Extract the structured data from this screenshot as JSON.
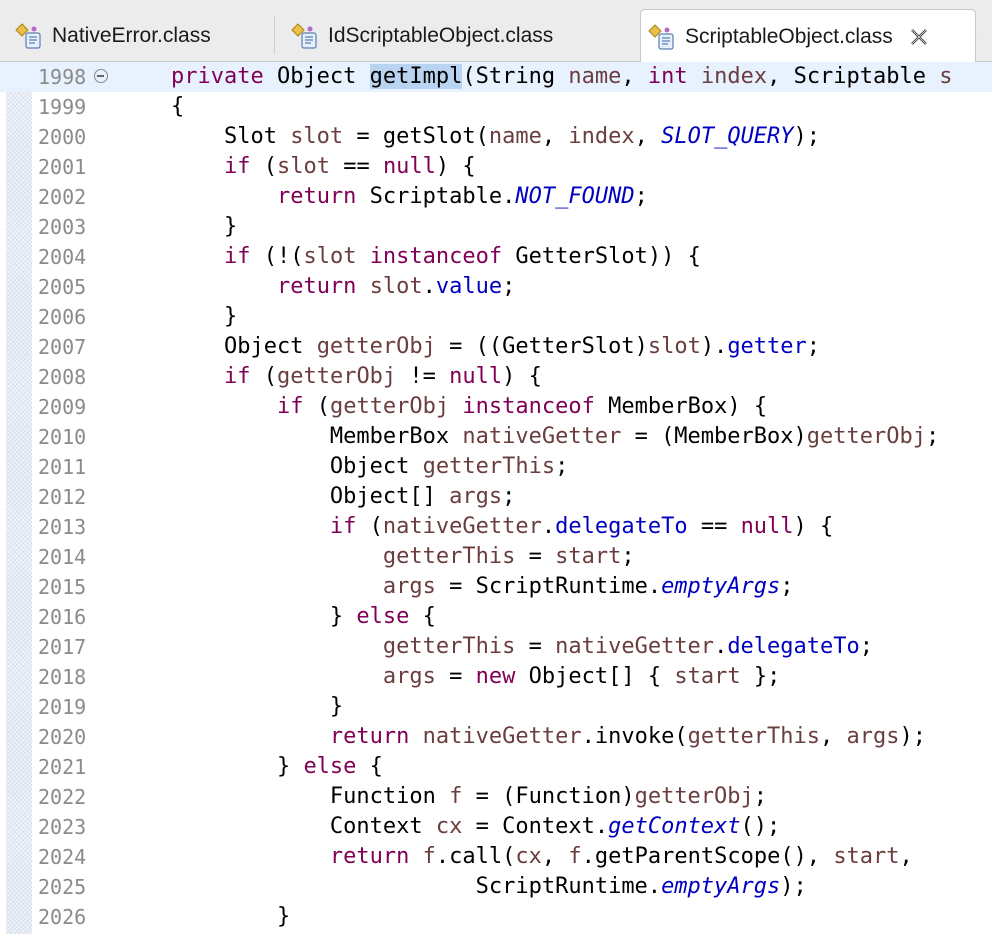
{
  "tabs": [
    {
      "label": "NativeError.class",
      "active": false
    },
    {
      "label": "IdScriptableObject.class",
      "active": false
    },
    {
      "label": "ScriptableObject.class",
      "active": true
    }
  ],
  "icons": {
    "tab_class": "class-file-icon",
    "close": "close-icon",
    "fold": "collapse-icon"
  },
  "colors": {
    "keyword": "#7f0055",
    "variable": "#6a3e3e",
    "field": "#0000c0",
    "current_line": "#e8f2fe",
    "highlight": "#b9d4f0"
  },
  "editor": {
    "lines": [
      {
        "n": "1998",
        "tokens": [
          [
            "    ",
            ""
          ],
          [
            "private",
            "k"
          ],
          [
            " Object ",
            ""
          ],
          [
            "getImpl",
            "hl"
          ],
          [
            "(String ",
            ""
          ],
          [
            "name",
            "v"
          ],
          [
            ", ",
            ""
          ],
          [
            "int",
            "k"
          ],
          [
            " ",
            ""
          ],
          [
            "index",
            "v"
          ],
          [
            ", Scriptable ",
            ""
          ],
          [
            "s",
            "v"
          ]
        ]
      },
      {
        "n": "1999",
        "tokens": [
          [
            "    {",
            ""
          ]
        ]
      },
      {
        "n": "2000",
        "tokens": [
          [
            "        Slot ",
            ""
          ],
          [
            "slot",
            "v"
          ],
          [
            " = getSlot(",
            ""
          ],
          [
            "name",
            "v"
          ],
          [
            ", ",
            ""
          ],
          [
            "index",
            "v"
          ],
          [
            ", ",
            ""
          ],
          [
            "SLOT_QUERY",
            "s"
          ],
          [
            ");",
            ""
          ]
        ]
      },
      {
        "n": "2001",
        "tokens": [
          [
            "        ",
            ""
          ],
          [
            "if",
            "k"
          ],
          [
            " (",
            ""
          ],
          [
            "slot",
            "v"
          ],
          [
            " == ",
            ""
          ],
          [
            "null",
            "k"
          ],
          [
            ") {",
            ""
          ]
        ]
      },
      {
        "n": "2002",
        "tokens": [
          [
            "            ",
            ""
          ],
          [
            "return",
            "k"
          ],
          [
            " Scriptable.",
            ""
          ],
          [
            "NOT_FOUND",
            "s"
          ],
          [
            ";",
            ""
          ]
        ]
      },
      {
        "n": "2003",
        "tokens": [
          [
            "        }",
            ""
          ]
        ]
      },
      {
        "n": "2004",
        "tokens": [
          [
            "        ",
            ""
          ],
          [
            "if",
            "k"
          ],
          [
            " (!(",
            ""
          ],
          [
            "slot",
            "v"
          ],
          [
            " ",
            ""
          ],
          [
            "instanceof",
            "k"
          ],
          [
            " GetterSlot)) {",
            ""
          ]
        ]
      },
      {
        "n": "2005",
        "tokens": [
          [
            "            ",
            ""
          ],
          [
            "return",
            "k"
          ],
          [
            " ",
            ""
          ],
          [
            "slot",
            "v"
          ],
          [
            ".",
            ""
          ],
          [
            "value",
            "f"
          ],
          [
            ";",
            ""
          ]
        ]
      },
      {
        "n": "2006",
        "tokens": [
          [
            "        }",
            ""
          ]
        ]
      },
      {
        "n": "2007",
        "tokens": [
          [
            "        Object ",
            ""
          ],
          [
            "getterObj",
            "v"
          ],
          [
            " = ((GetterSlot)",
            ""
          ],
          [
            "slot",
            "v"
          ],
          [
            ").",
            ""
          ],
          [
            "getter",
            "f"
          ],
          [
            ";",
            ""
          ]
        ]
      },
      {
        "n": "2008",
        "tokens": [
          [
            "        ",
            ""
          ],
          [
            "if",
            "k"
          ],
          [
            " (",
            ""
          ],
          [
            "getterObj",
            "v"
          ],
          [
            " != ",
            ""
          ],
          [
            "null",
            "k"
          ],
          [
            ") {",
            ""
          ]
        ]
      },
      {
        "n": "2009",
        "tokens": [
          [
            "            ",
            ""
          ],
          [
            "if",
            "k"
          ],
          [
            " (",
            ""
          ],
          [
            "getterObj",
            "v"
          ],
          [
            " ",
            ""
          ],
          [
            "instanceof",
            "k"
          ],
          [
            " MemberBox) {",
            ""
          ]
        ]
      },
      {
        "n": "2010",
        "tokens": [
          [
            "                MemberBox ",
            ""
          ],
          [
            "nativeGetter",
            "v"
          ],
          [
            " = (MemberBox)",
            ""
          ],
          [
            "getterObj",
            "v"
          ],
          [
            ";",
            ""
          ]
        ]
      },
      {
        "n": "2011",
        "tokens": [
          [
            "                Object ",
            ""
          ],
          [
            "getterThis",
            "v"
          ],
          [
            ";",
            ""
          ]
        ]
      },
      {
        "n": "2012",
        "tokens": [
          [
            "                Object[] ",
            ""
          ],
          [
            "args",
            "v"
          ],
          [
            ";",
            ""
          ]
        ]
      },
      {
        "n": "2013",
        "tokens": [
          [
            "                ",
            ""
          ],
          [
            "if",
            "k"
          ],
          [
            " (",
            ""
          ],
          [
            "nativeGetter",
            "v"
          ],
          [
            ".",
            ""
          ],
          [
            "delegateTo",
            "f"
          ],
          [
            " == ",
            ""
          ],
          [
            "null",
            "k"
          ],
          [
            ") {",
            ""
          ]
        ]
      },
      {
        "n": "2014",
        "tokens": [
          [
            "                    ",
            ""
          ],
          [
            "getterThis",
            "v"
          ],
          [
            " = ",
            ""
          ],
          [
            "start",
            "v"
          ],
          [
            ";",
            ""
          ]
        ]
      },
      {
        "n": "2015",
        "tokens": [
          [
            "                    ",
            ""
          ],
          [
            "args",
            "v"
          ],
          [
            " = ScriptRuntime.",
            ""
          ],
          [
            "emptyArgs",
            "s"
          ],
          [
            ";",
            ""
          ]
        ]
      },
      {
        "n": "2016",
        "tokens": [
          [
            "                } ",
            ""
          ],
          [
            "else",
            "k"
          ],
          [
            " {",
            ""
          ]
        ]
      },
      {
        "n": "2017",
        "tokens": [
          [
            "                    ",
            ""
          ],
          [
            "getterThis",
            "v"
          ],
          [
            " = ",
            ""
          ],
          [
            "nativeGetter",
            "v"
          ],
          [
            ".",
            ""
          ],
          [
            "delegateTo",
            "f"
          ],
          [
            ";",
            ""
          ]
        ]
      },
      {
        "n": "2018",
        "tokens": [
          [
            "                    ",
            ""
          ],
          [
            "args",
            "v"
          ],
          [
            " = ",
            ""
          ],
          [
            "new",
            "k"
          ],
          [
            " Object[] { ",
            ""
          ],
          [
            "start",
            "v"
          ],
          [
            " };",
            ""
          ]
        ]
      },
      {
        "n": "2019",
        "tokens": [
          [
            "                }",
            ""
          ]
        ]
      },
      {
        "n": "2020",
        "tokens": [
          [
            "                ",
            ""
          ],
          [
            "return",
            "k"
          ],
          [
            " ",
            ""
          ],
          [
            "nativeGetter",
            "v"
          ],
          [
            ".invoke(",
            ""
          ],
          [
            "getterThis",
            "v"
          ],
          [
            ", ",
            ""
          ],
          [
            "args",
            "v"
          ],
          [
            ");",
            ""
          ]
        ]
      },
      {
        "n": "2021",
        "tokens": [
          [
            "            } ",
            ""
          ],
          [
            "else",
            "k"
          ],
          [
            " {",
            ""
          ]
        ]
      },
      {
        "n": "2022",
        "tokens": [
          [
            "                Function ",
            ""
          ],
          [
            "f",
            "v"
          ],
          [
            " = (Function)",
            ""
          ],
          [
            "getterObj",
            "v"
          ],
          [
            ";",
            ""
          ]
        ]
      },
      {
        "n": "2023",
        "tokens": [
          [
            "                Context ",
            ""
          ],
          [
            "cx",
            "v"
          ],
          [
            " = Context.",
            ""
          ],
          [
            "getContext",
            "s"
          ],
          [
            "();",
            ""
          ]
        ]
      },
      {
        "n": "2024",
        "tokens": [
          [
            "                ",
            ""
          ],
          [
            "return",
            "k"
          ],
          [
            " ",
            ""
          ],
          [
            "f",
            "v"
          ],
          [
            ".call(",
            ""
          ],
          [
            "cx",
            "v"
          ],
          [
            ", ",
            ""
          ],
          [
            "f",
            "v"
          ],
          [
            ".getParentScope(), ",
            ""
          ],
          [
            "start",
            "v"
          ],
          [
            ",",
            ""
          ]
        ]
      },
      {
        "n": "2025",
        "tokens": [
          [
            "                           ScriptRuntime.",
            ""
          ],
          [
            "emptyArgs",
            "s"
          ],
          [
            ");",
            ""
          ]
        ]
      },
      {
        "n": "2026",
        "tokens": [
          [
            "            }",
            ""
          ]
        ]
      }
    ]
  }
}
